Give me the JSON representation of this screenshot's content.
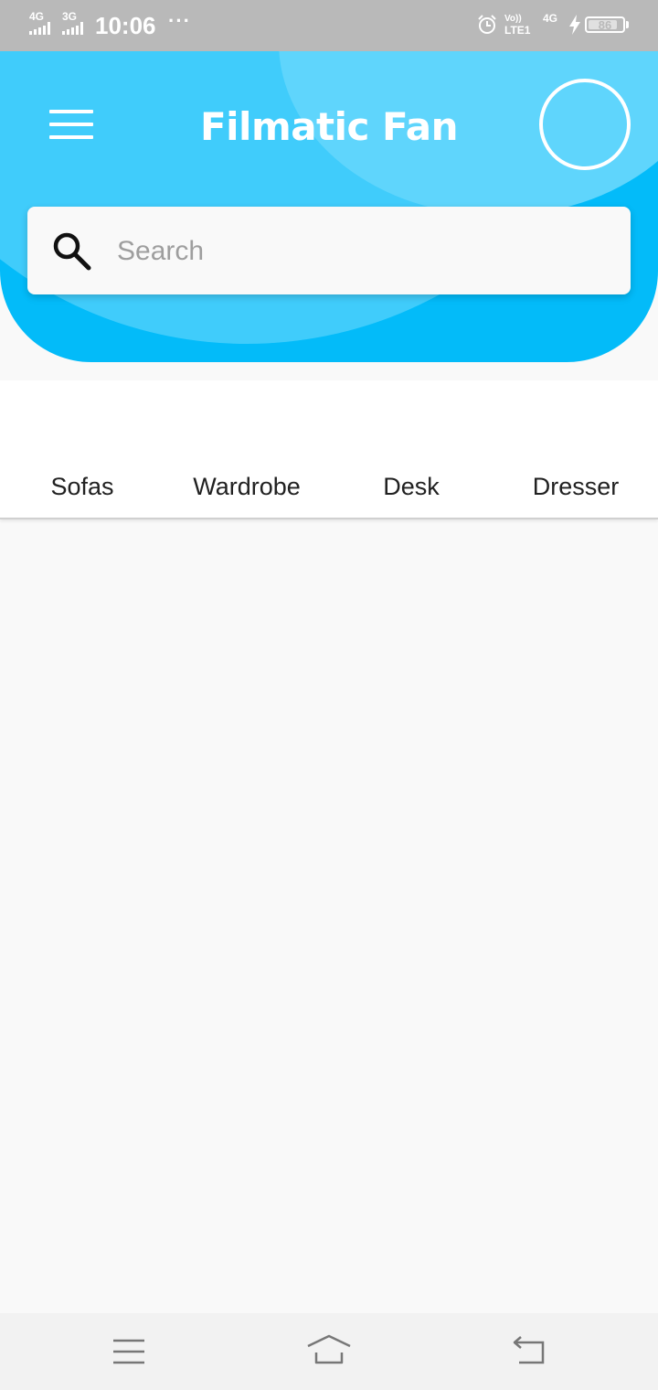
{
  "status_bar": {
    "network_1": "4G",
    "network_2": "3G",
    "time": "10:06",
    "more": "···",
    "volte": "Vo))",
    "lte": "LTE1",
    "network_3": "4G",
    "battery_level": "86",
    "battery_fraction": 0.86
  },
  "header": {
    "title": "Filmatic Fan",
    "menu_icon": "hamburger-menu-icon",
    "avatar_icon": "avatar-circle",
    "accent_color": "#03bbf9"
  },
  "search": {
    "placeholder": "Search",
    "value": "",
    "icon": "search-icon"
  },
  "tabs": [
    {
      "label": "Sofas"
    },
    {
      "label": "Wardrobe"
    },
    {
      "label": "Desk"
    },
    {
      "label": "Dresser"
    }
  ],
  "nav_bar": {
    "menu_icon": "recent-apps-icon",
    "home_icon": "home-icon",
    "back_icon": "back-icon"
  }
}
